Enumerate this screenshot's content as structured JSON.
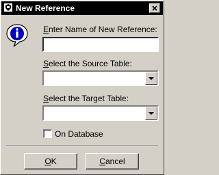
{
  "window": {
    "title": "New Reference",
    "title_icon": "reference-app-icon",
    "close_icon": "close-icon"
  },
  "dialog": {
    "info_icon": "info-icon",
    "name_label_mnemonic": "E",
    "name_label_rest": "nter Name of New Reference:",
    "name_value": "",
    "source_label_mnemonic": "S",
    "source_label_rest": "elect the Source Table:",
    "source_value": "",
    "target_label_mnemonic": "S",
    "target_label_rest": "elect the Target Table:",
    "target_value": "",
    "on_database_label": "On Database",
    "on_database_checked": false
  },
  "buttons": {
    "ok_mnemonic": "O",
    "ok_rest": "K",
    "cancel_mnemonic": "C",
    "cancel_rest": "ancel"
  },
  "colors": {
    "face": "#d4d0c8",
    "titlebar": "#000000",
    "info_blue": "#0000c0"
  }
}
